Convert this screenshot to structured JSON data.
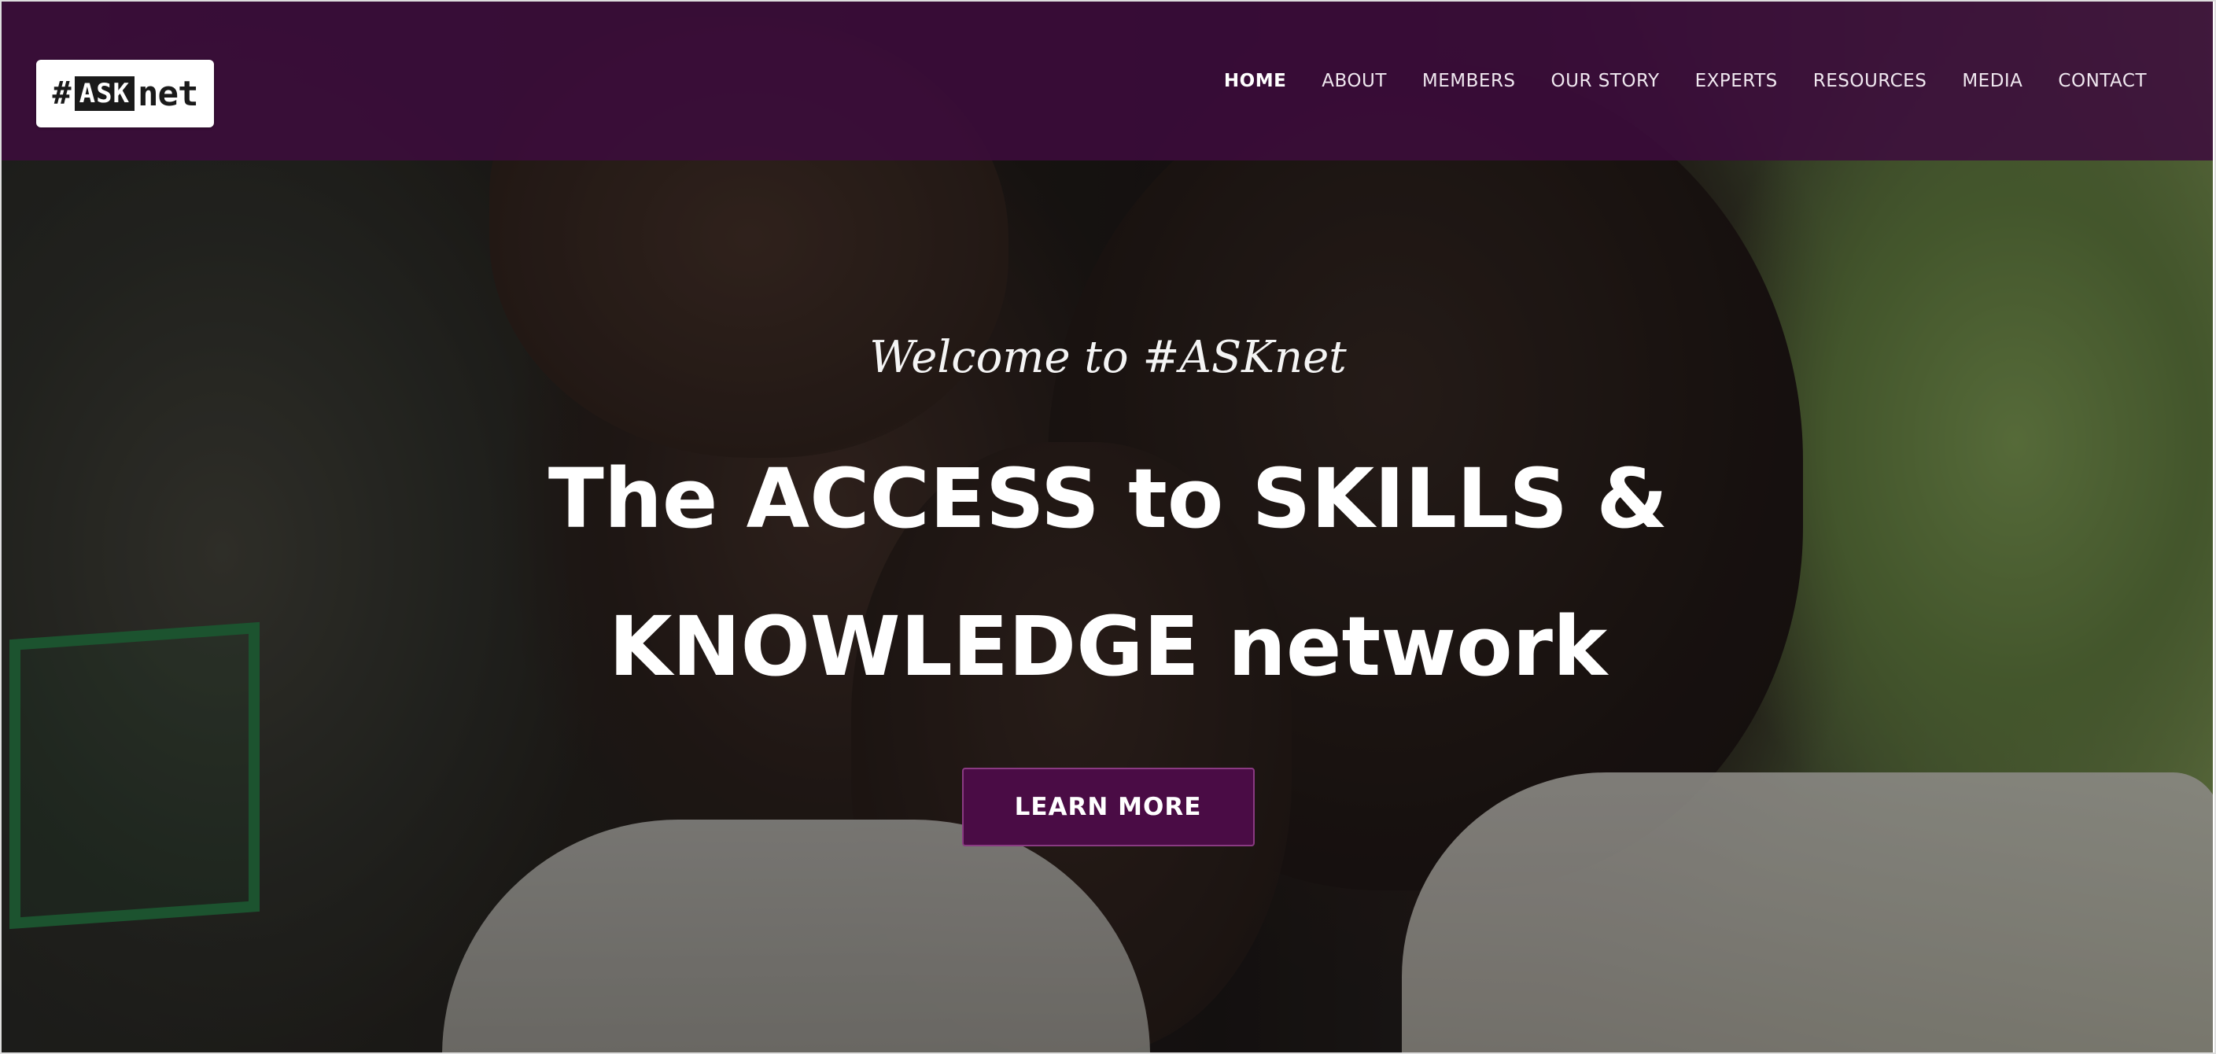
{
  "logo": {
    "hash": "#",
    "ask": "ASK",
    "net": "net"
  },
  "nav": {
    "items": [
      {
        "label": "HOME",
        "active": true
      },
      {
        "label": "ABOUT"
      },
      {
        "label": "MEMBERS"
      },
      {
        "label": "OUR STORY"
      },
      {
        "label": "EXPERTS"
      },
      {
        "label": "RESOURCES"
      },
      {
        "label": "MEDIA"
      },
      {
        "label": "CONTACT"
      }
    ]
  },
  "hero": {
    "welcome": "Welcome to #ASKnet",
    "headline_line1": "The ACCESS to SKILLS &",
    "headline_line2": "KNOWLEDGE network",
    "cta_label": "LEARN MORE"
  },
  "colors": {
    "header_bg": "#3c0c3c",
    "cta_bg": "#4a0c45",
    "text": "#ffffff"
  }
}
